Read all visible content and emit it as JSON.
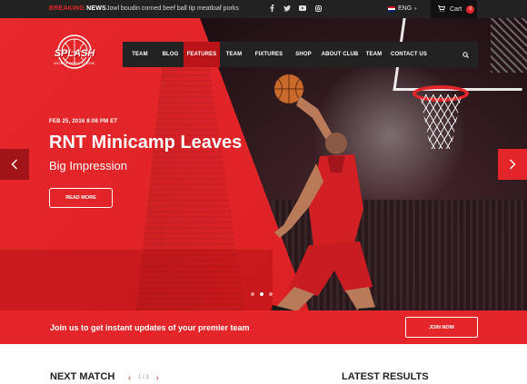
{
  "topbar": {
    "breaking_label_1": "BREAKING",
    "breaking_label_2": "NEWS",
    "ticker_text": "Jowl boudin corned beef ball tip meatloaf porks",
    "social_icons": [
      "facebook-icon",
      "twitter-icon",
      "youtube-icon",
      "instagram-icon"
    ],
    "language": "ENG",
    "cart_label": "Cart",
    "cart_count": "0"
  },
  "logo": {
    "name": "SPLASH",
    "tagline": "WORDPRESS THEME"
  },
  "nav": {
    "items": [
      "TEAM",
      "BLOG",
      "FEATURES",
      "TEAM",
      "FIXTURES",
      "SHOP",
      "ABOUT CLUB",
      "TEAM",
      "CONTACT US"
    ],
    "active_index": 2
  },
  "hero": {
    "date": "FEB 25, 2016 8:08 PM ET",
    "headline": "RNT Minicamp Leaves",
    "subhead": "Big Impression",
    "read_more": "READ MORE",
    "slide_count": 3,
    "active_slide": 1
  },
  "join": {
    "text": "Join us to get instant updates of your premier team",
    "button": "JOIN NOW"
  },
  "bottom": {
    "next_match_title": "NEXT MATCH",
    "pager": "1 / 3",
    "latest_results_title": "LATEST RESULTS"
  },
  "colors": {
    "accent": "#e4262a",
    "dark": "#222222",
    "nav_active": "#b81418"
  }
}
